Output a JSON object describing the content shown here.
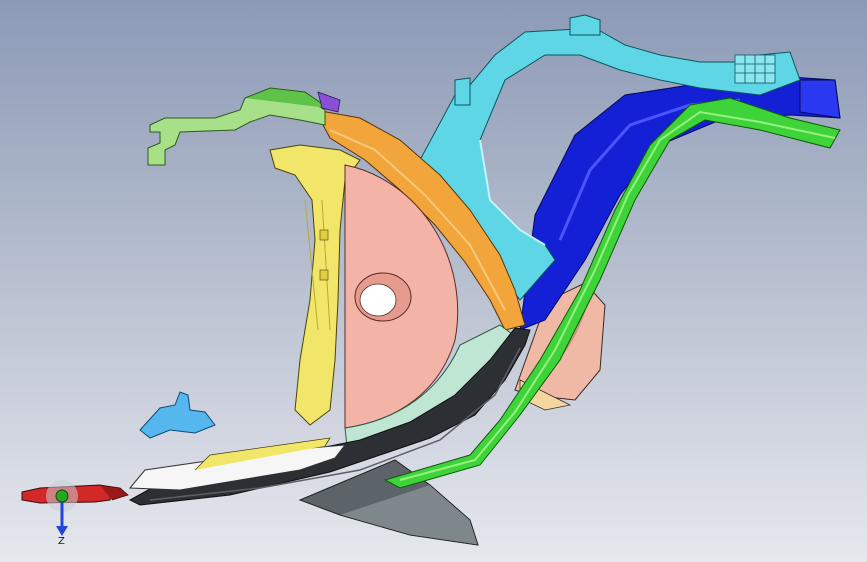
{
  "viewport": {
    "background_top": "#8c9ab6",
    "background_bottom": "#e6e8ee"
  },
  "model": {
    "parts": [
      "green-bracket",
      "light-green-clip",
      "yellow-panel",
      "salmon-disc",
      "orange-trim",
      "cyan-frame",
      "blue-support",
      "green-rail",
      "pink-loop",
      "white-step",
      "dark-shell",
      "grey-fin",
      "blue-clip",
      "red-pin"
    ],
    "colors": {
      "green": "#5fc34a",
      "light_green": "#a8e08a",
      "yellow": "#f2e66a",
      "salmon": "#f3b3a6",
      "orange": "#f1a53a",
      "cyan": "#5fd6e6",
      "blue": "#1420d6",
      "rail_green": "#3fd33a",
      "pink": "#f0b9a6",
      "white": "#f6f6f6",
      "dark": "#2c2f33",
      "grey": "#5c6469",
      "clip_blue": "#56b6ee",
      "red": "#d22828"
    }
  },
  "triad": {
    "axis_label": "Z",
    "x_color": "#22aa22",
    "z_color": "#2244dd"
  }
}
